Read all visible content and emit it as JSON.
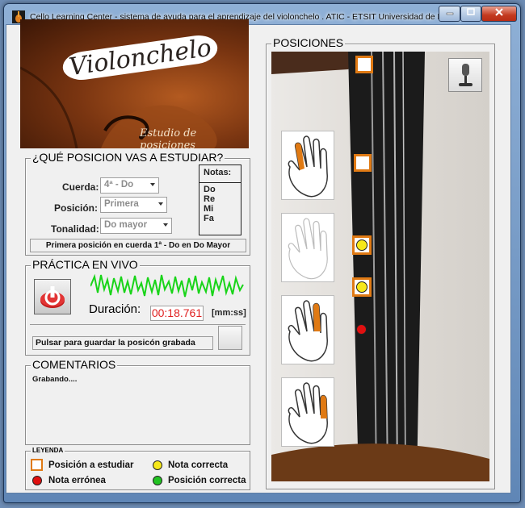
{
  "window": {
    "title": "Cello Learning Center - sistema de ayuda para el aprendizaje del violonchelo . ATIC - ETSIT Universidad de Málaga."
  },
  "banner": {
    "title": "Violonchelo",
    "subtitle": "Estudio de posiciones"
  },
  "study": {
    "title": "¿QUÉ POSICION VAS A ESTUDIAR?",
    "string_label": "Cuerda:",
    "string_value": "4ª - Do",
    "position_label": "Posición:",
    "position_value": "Primera",
    "key_label": "Tonalidad:",
    "key_value": "Do mayor",
    "notes_title": "Notas:",
    "notes": [
      "Do",
      "Re",
      "Mi",
      "Fa"
    ],
    "summary": "Primera posición en cuerda 1ª - Do en Do Mayor"
  },
  "practice": {
    "title": "PRÁCTICA EN VIVO",
    "duration_label": "Duración:",
    "duration_value": "00:18.761",
    "duration_unit": "[mm:ss]",
    "save_label": "Pulsar para guardar la posicón grabada"
  },
  "comments": {
    "title": "COMENTARIOS",
    "text": "Grabando...."
  },
  "legend": {
    "title": "LEYENDA",
    "study_position": "Posición a estudiar",
    "correct_note": "Nota correcta",
    "wrong_note": "Nota errónea",
    "correct_position": "Posición correcta"
  },
  "positions": {
    "title": "POSICIONES"
  },
  "colors": {
    "accent_orange": "#e07a14",
    "correct_yellow": "#f6e81a",
    "wrong_red": "#e01010",
    "correct_green": "#22c322",
    "waveform_green": "#19d419",
    "duration_red": "#e02020"
  },
  "icons": {
    "app": "cello-icon",
    "record": "power-icon",
    "microphone": "microphone-icon"
  }
}
